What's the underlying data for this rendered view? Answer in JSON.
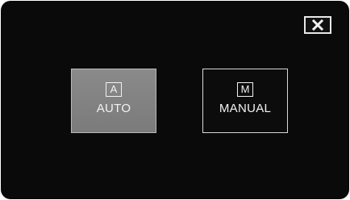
{
  "close_button": {
    "icon": "close-icon"
  },
  "modes": {
    "auto": {
      "icon_letter": "A",
      "label": "AUTO",
      "selected": true
    },
    "manual": {
      "icon_letter": "M",
      "label": "MANUAL",
      "selected": false
    }
  },
  "colors": {
    "background": "#0a0a0a",
    "selected_button": "#858585",
    "unselected_button": "#0c0c0c",
    "text": "#f2f2f2"
  }
}
